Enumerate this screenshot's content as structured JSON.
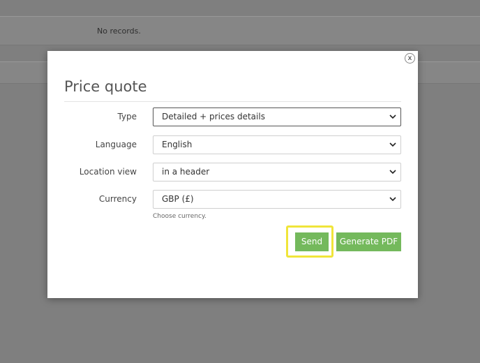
{
  "background": {
    "empty_state": "No records."
  },
  "modal": {
    "title": "Price quote",
    "close_label": "x",
    "fields": [
      {
        "label": "Type",
        "value": "Detailed + prices details",
        "focused": true
      },
      {
        "label": "Language",
        "value": "English",
        "focused": false
      },
      {
        "label": "Location view",
        "value": "in a header",
        "focused": false
      },
      {
        "label": "Currency",
        "value": "GBP (£)",
        "focused": false
      }
    ],
    "currency_help": "Choose currency.",
    "buttons": {
      "send": "Send",
      "generate_pdf": "Generate PDF"
    }
  },
  "colors": {
    "overlay": "#7f7f7f",
    "button_green": "#74b95c",
    "highlight_yellow": "#f0e53a"
  }
}
